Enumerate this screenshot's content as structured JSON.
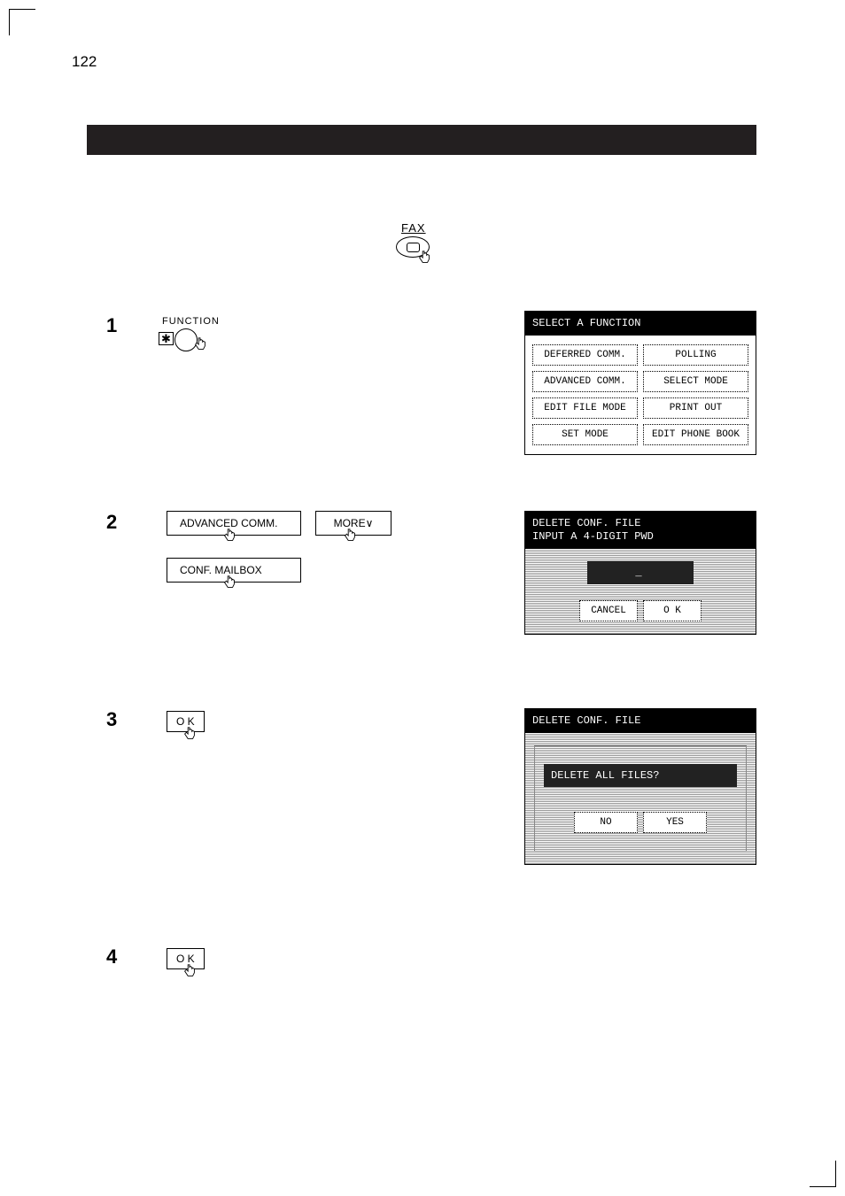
{
  "page_number": "122",
  "fax_label": "FAX",
  "function_label": "FUNCTION",
  "steps": {
    "1": "1",
    "2": "2",
    "3": "3",
    "4": "4"
  },
  "softkeys": {
    "advanced": "ADVANCED COMM.",
    "more": "MORE∨",
    "confmb": "CONF. MAILBOX"
  },
  "ok_label": "O K",
  "star": "✱",
  "screen1": {
    "title": "SELECT A FUNCTION",
    "btns": [
      "DEFERRED COMM.",
      "POLLING",
      "ADVANCED COMM.",
      "SELECT MODE",
      "EDIT FILE MODE",
      "PRINT OUT",
      "SET MODE",
      "EDIT PHONE BOOK"
    ]
  },
  "screen2": {
    "title1": "DELETE CONF. FILE",
    "title2": "INPUT A 4-DIGIT PWD",
    "pwd": "_",
    "cancel": "CANCEL",
    "ok": "O K"
  },
  "screen3": {
    "title": "DELETE CONF. FILE",
    "question": "DELETE ALL FILES?",
    "no": "NO",
    "yes": "YES"
  }
}
